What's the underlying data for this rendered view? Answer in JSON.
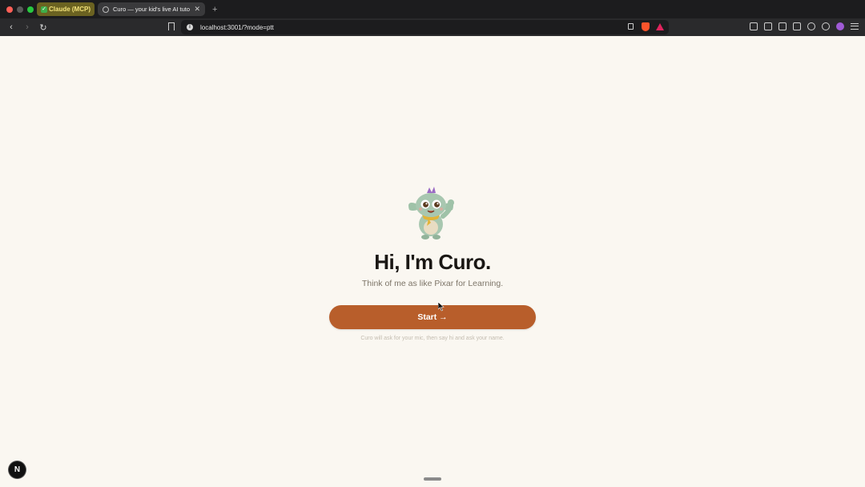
{
  "browser": {
    "tab_group_label": "Claude (MCP)",
    "active_tab_title": "Curo — your kid's live AI tutor",
    "new_tab_label": "+",
    "url": "localhost:3001/?mode=ptt"
  },
  "page": {
    "headline": "Hi, I'm Curo.",
    "subtitle": "Think of me as like Pixar for Learning.",
    "start_label": "Start →",
    "hint": "Curo will ask for your mic, then say hi and ask your name."
  },
  "dev_badge_label": "N",
  "colors": {
    "background": "#faf7f1",
    "accent": "#b85e2b",
    "headline": "#1a1714"
  }
}
